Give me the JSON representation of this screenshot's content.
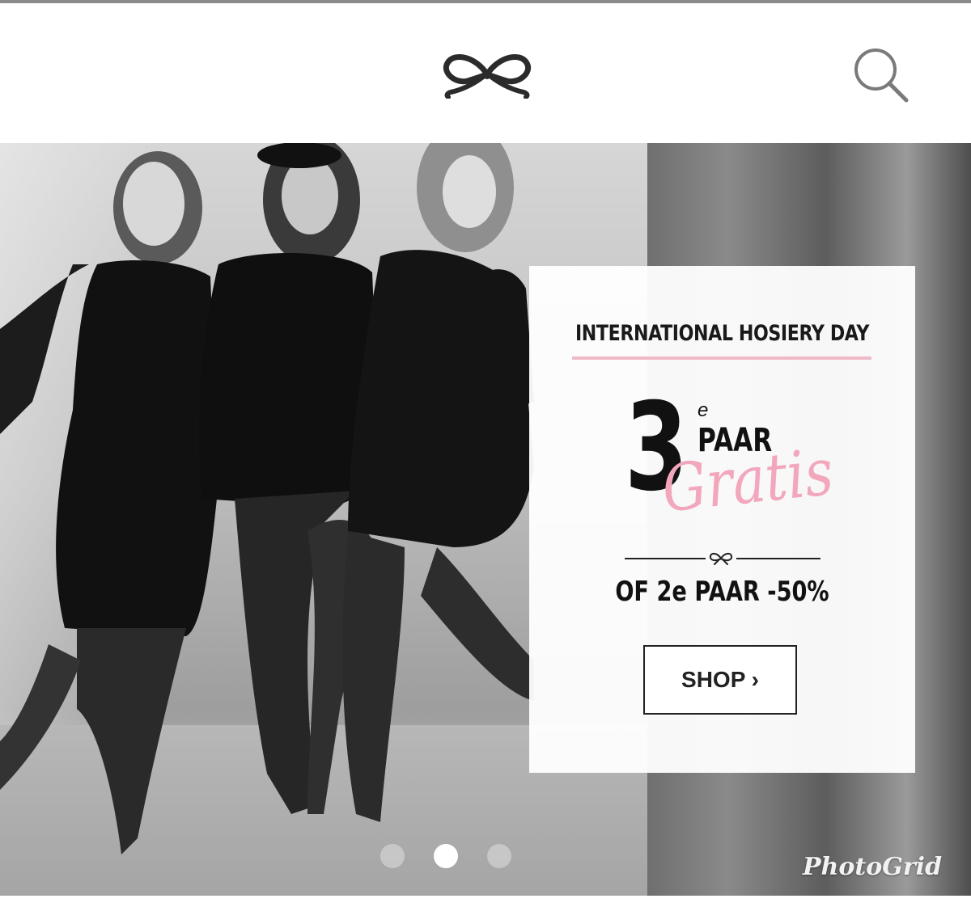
{
  "header": {
    "logo_icon": "bow-logo-icon",
    "search_icon": "search-icon"
  },
  "promo": {
    "heading": "INTERNATIONAL HOSIERY DAY",
    "number": "3",
    "number_suffix": "e",
    "pair_word": "PAAR",
    "free_word": "Gratis",
    "sub_offer": "OF 2e PAAR -50%",
    "shop_label": "SHOP ›"
  },
  "carousel": {
    "active_index": 1,
    "dot_count": 3
  },
  "watermark": "PhotoGrid",
  "colors": {
    "accent_pink": "#f2a7bd",
    "rule_pink": "#f0b9c7",
    "text_dark": "#111111"
  }
}
